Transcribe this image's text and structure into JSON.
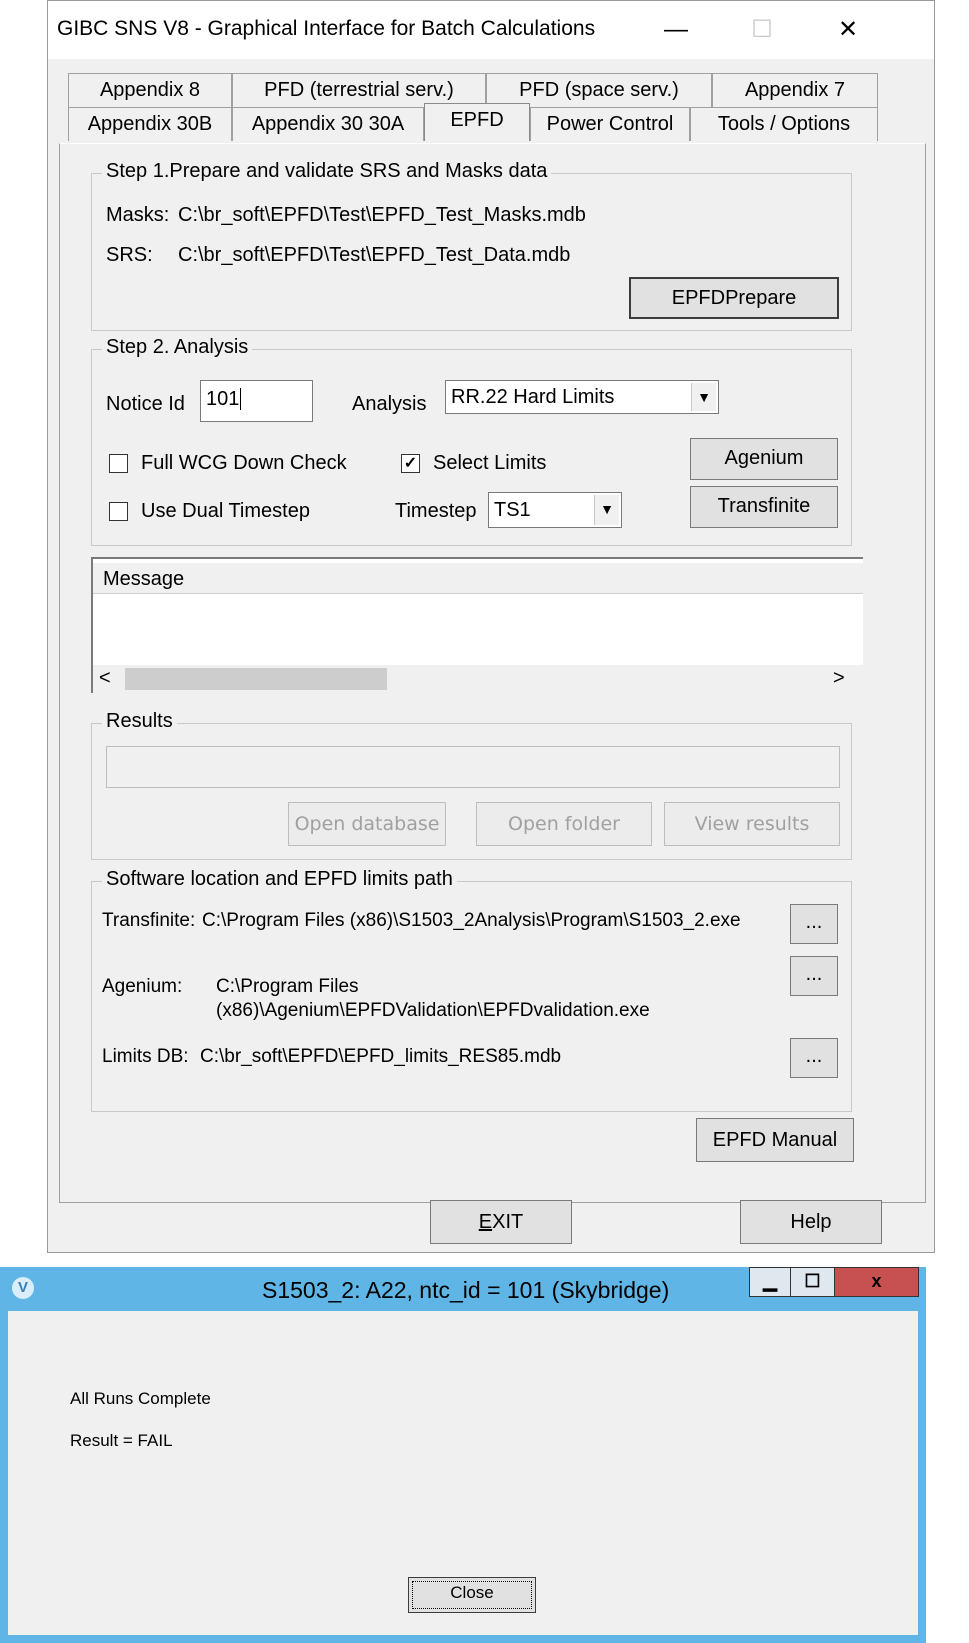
{
  "main_window": {
    "title": "GIBC SNS V8 - Graphical Interface for Batch Calculations",
    "caption_buttons": {
      "minimize": "—",
      "maximize": "☐",
      "close": "✕"
    },
    "tabs_row1": [
      "Appendix 8",
      "PFD (terrestrial serv.)",
      "PFD (space serv.)",
      "Appendix 7"
    ],
    "tabs_row2": [
      "Appendix 30B",
      "Appendix 30 30A",
      "EPFD",
      "Power Control",
      "Tools / Options"
    ],
    "active_tab": "EPFD",
    "step1": {
      "legend": "Step 1.Prepare and validate SRS and Masks data",
      "masks_label": "Masks:",
      "masks_path": "C:\\br_soft\\EPFD\\Test\\EPFD_Test_Masks.mdb",
      "srs_label": "SRS:",
      "srs_path": "C:\\br_soft\\EPFD\\Test\\EPFD_Test_Data.mdb",
      "prepare_button": "EPFDPrepare"
    },
    "step2": {
      "legend": "Step 2. Analysis",
      "notice_label": "Notice Id",
      "notice_value": "101",
      "analysis_label": "Analysis",
      "analysis_value": "RR.22 Hard Limits",
      "full_wcg_label": "Full WCG Down Check",
      "full_wcg_checked": false,
      "select_limits_label": "Select Limits",
      "select_limits_checked": true,
      "dual_timestep_label": "Use Dual Timestep",
      "dual_timestep_checked": false,
      "timestep_label": "Timestep",
      "timestep_value": "TS1",
      "agenium_button": "Agenium",
      "transfinite_button": "Transfinite"
    },
    "message": {
      "header": "Message"
    },
    "results": {
      "legend": "Results",
      "open_database": "Open database",
      "open_folder": "Open folder",
      "view_results": "View results"
    },
    "software": {
      "legend": "Software location and EPFD limits path",
      "transfinite_label": "Transfinite:",
      "transfinite_path": "C:\\Program Files (x86)\\S1503_2Analysis\\Program\\S1503_2.exe",
      "agenium_label": "Agenium:",
      "agenium_path_line1": "C:\\Program Files",
      "agenium_path_line2": "(x86)\\Agenium\\EPFDValidation\\EPFDvalidation.exe",
      "limits_label": "Limits DB:",
      "limits_path": "C:\\br_soft\\EPFD\\EPFD_limits_RES85.mdb",
      "browse_label": "..."
    },
    "manual_button": "EPFD Manual",
    "exit_button": "EXIT",
    "help_button": "Help"
  },
  "popup": {
    "title": "S1503_2: A22, ntc_id = 101 (Skybridge)",
    "line1": "All Runs Complete",
    "line2": "Result = FAIL",
    "close_button": "Close",
    "caption_buttons": {
      "minimize": "▁",
      "maximize": "☐",
      "close": "x"
    }
  },
  "colors": {
    "window_bg": "#f0f0f0",
    "popup_frame": "#5fb6e6",
    "popup_close": "#c75050"
  }
}
